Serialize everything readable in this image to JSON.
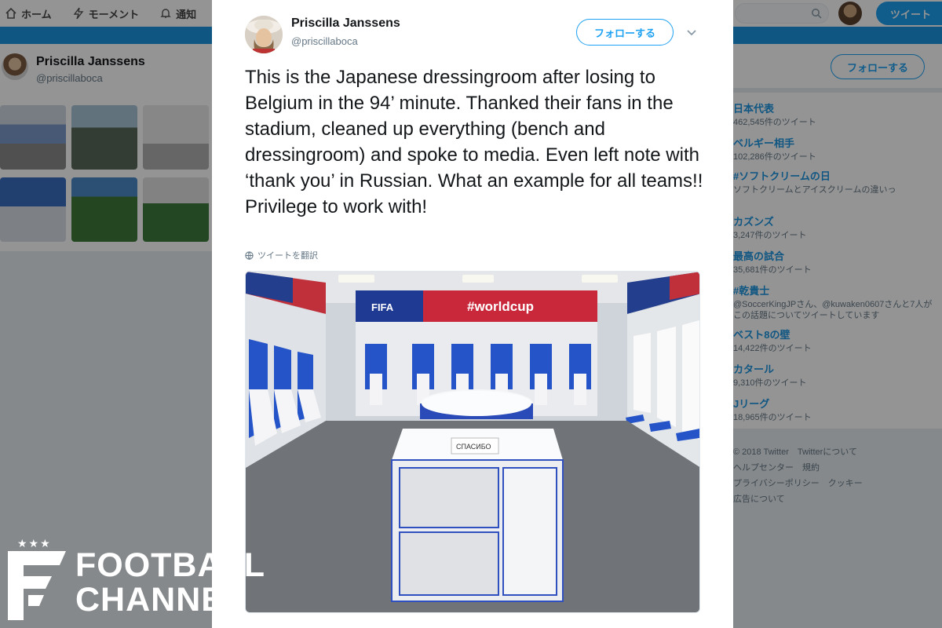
{
  "topnav": {
    "home": "ホーム",
    "moments": "モーメント",
    "notifications": "通知",
    "tweet_button": "ツイート"
  },
  "profile": {
    "name": "Priscilla Janssens",
    "handle": "@priscillaboca",
    "follow_label": "フォローする"
  },
  "trends": [
    {
      "name": "日本代表",
      "meta": "462,545件のツイート"
    },
    {
      "name": "ベルギー相手",
      "meta": "102,286件のツイート"
    },
    {
      "name": "#ソフトクリームの日",
      "meta": "ソフトクリームとアイスクリームの違いっ"
    },
    {
      "name": "カズンズ",
      "meta": "3,247件のツイート"
    },
    {
      "name": "最高の試合",
      "meta": "35,681件のツイート"
    },
    {
      "name": "#乾貴士",
      "meta": "@SoccerKingJPさん、@kuwaken0607さんと7人がこの話題についてツイートしています"
    },
    {
      "name": "ベスト8の壁",
      "meta": "14,422件のツイート"
    },
    {
      "name": "カタール",
      "meta": "9,310件のツイート"
    },
    {
      "name": "Jリーグ",
      "meta": "18,965件のツイート"
    }
  ],
  "footer": {
    "line1": "© 2018 Twitter　Twitterについて",
    "line2": "ヘルプセンター　規約",
    "line3": "プライバシーポリシー　クッキー",
    "line4": "広告について"
  },
  "tweet": {
    "name": "Priscilla Janssens",
    "handle": "@priscillaboca",
    "follow_label": "フォローする",
    "text": "This is the Japanese dressingroom after losing to Belgium in the 94’ minute. Thanked their fans in the stadium, cleaned up everything (bench and dressingroom) and spoke to media. Even left note with ‘thank you’ in Russian. What an example for all teams!! Privilege to work with!",
    "translate_label": "ツイートを翻訳",
    "photo": {
      "banner_fifa": "FIFA",
      "banner_tag": "#worldcup",
      "note": "СПАСИБО"
    }
  },
  "watermark": {
    "stars": "★★★",
    "line1": "FOOTBALL",
    "line2": "CHANNEL"
  },
  "colors": {
    "twitter_blue": "#1da1f2",
    "banner_blue": "#1b95e0",
    "fifa_blue": "#1f3a93",
    "fifa_red": "#c8283a"
  }
}
